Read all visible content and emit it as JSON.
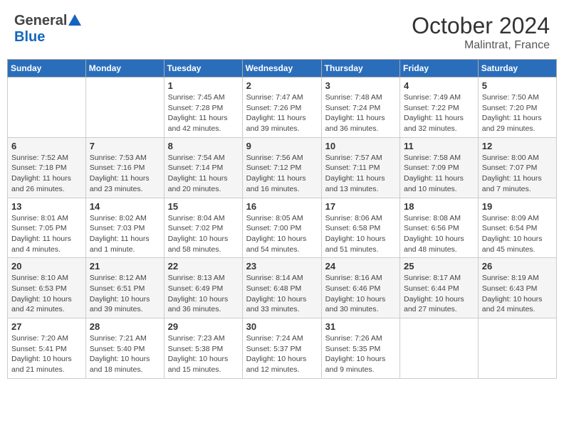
{
  "header": {
    "logo_general": "General",
    "logo_blue": "Blue",
    "month": "October 2024",
    "location": "Malintrat, France"
  },
  "days_of_week": [
    "Sunday",
    "Monday",
    "Tuesday",
    "Wednesday",
    "Thursday",
    "Friday",
    "Saturday"
  ],
  "weeks": [
    [
      {
        "day": "",
        "details": ""
      },
      {
        "day": "",
        "details": ""
      },
      {
        "day": "1",
        "details": "Sunrise: 7:45 AM\nSunset: 7:28 PM\nDaylight: 11 hours and 42 minutes."
      },
      {
        "day": "2",
        "details": "Sunrise: 7:47 AM\nSunset: 7:26 PM\nDaylight: 11 hours and 39 minutes."
      },
      {
        "day": "3",
        "details": "Sunrise: 7:48 AM\nSunset: 7:24 PM\nDaylight: 11 hours and 36 minutes."
      },
      {
        "day": "4",
        "details": "Sunrise: 7:49 AM\nSunset: 7:22 PM\nDaylight: 11 hours and 32 minutes."
      },
      {
        "day": "5",
        "details": "Sunrise: 7:50 AM\nSunset: 7:20 PM\nDaylight: 11 hours and 29 minutes."
      }
    ],
    [
      {
        "day": "6",
        "details": "Sunrise: 7:52 AM\nSunset: 7:18 PM\nDaylight: 11 hours and 26 minutes."
      },
      {
        "day": "7",
        "details": "Sunrise: 7:53 AM\nSunset: 7:16 PM\nDaylight: 11 hours and 23 minutes."
      },
      {
        "day": "8",
        "details": "Sunrise: 7:54 AM\nSunset: 7:14 PM\nDaylight: 11 hours and 20 minutes."
      },
      {
        "day": "9",
        "details": "Sunrise: 7:56 AM\nSunset: 7:12 PM\nDaylight: 11 hours and 16 minutes."
      },
      {
        "day": "10",
        "details": "Sunrise: 7:57 AM\nSunset: 7:11 PM\nDaylight: 11 hours and 13 minutes."
      },
      {
        "day": "11",
        "details": "Sunrise: 7:58 AM\nSunset: 7:09 PM\nDaylight: 11 hours and 10 minutes."
      },
      {
        "day": "12",
        "details": "Sunrise: 8:00 AM\nSunset: 7:07 PM\nDaylight: 11 hours and 7 minutes."
      }
    ],
    [
      {
        "day": "13",
        "details": "Sunrise: 8:01 AM\nSunset: 7:05 PM\nDaylight: 11 hours and 4 minutes."
      },
      {
        "day": "14",
        "details": "Sunrise: 8:02 AM\nSunset: 7:03 PM\nDaylight: 11 hours and 1 minute."
      },
      {
        "day": "15",
        "details": "Sunrise: 8:04 AM\nSunset: 7:02 PM\nDaylight: 10 hours and 58 minutes."
      },
      {
        "day": "16",
        "details": "Sunrise: 8:05 AM\nSunset: 7:00 PM\nDaylight: 10 hours and 54 minutes."
      },
      {
        "day": "17",
        "details": "Sunrise: 8:06 AM\nSunset: 6:58 PM\nDaylight: 10 hours and 51 minutes."
      },
      {
        "day": "18",
        "details": "Sunrise: 8:08 AM\nSunset: 6:56 PM\nDaylight: 10 hours and 48 minutes."
      },
      {
        "day": "19",
        "details": "Sunrise: 8:09 AM\nSunset: 6:54 PM\nDaylight: 10 hours and 45 minutes."
      }
    ],
    [
      {
        "day": "20",
        "details": "Sunrise: 8:10 AM\nSunset: 6:53 PM\nDaylight: 10 hours and 42 minutes."
      },
      {
        "day": "21",
        "details": "Sunrise: 8:12 AM\nSunset: 6:51 PM\nDaylight: 10 hours and 39 minutes."
      },
      {
        "day": "22",
        "details": "Sunrise: 8:13 AM\nSunset: 6:49 PM\nDaylight: 10 hours and 36 minutes."
      },
      {
        "day": "23",
        "details": "Sunrise: 8:14 AM\nSunset: 6:48 PM\nDaylight: 10 hours and 33 minutes."
      },
      {
        "day": "24",
        "details": "Sunrise: 8:16 AM\nSunset: 6:46 PM\nDaylight: 10 hours and 30 minutes."
      },
      {
        "day": "25",
        "details": "Sunrise: 8:17 AM\nSunset: 6:44 PM\nDaylight: 10 hours and 27 minutes."
      },
      {
        "day": "26",
        "details": "Sunrise: 8:19 AM\nSunset: 6:43 PM\nDaylight: 10 hours and 24 minutes."
      }
    ],
    [
      {
        "day": "27",
        "details": "Sunrise: 7:20 AM\nSunset: 5:41 PM\nDaylight: 10 hours and 21 minutes."
      },
      {
        "day": "28",
        "details": "Sunrise: 7:21 AM\nSunset: 5:40 PM\nDaylight: 10 hours and 18 minutes."
      },
      {
        "day": "29",
        "details": "Sunrise: 7:23 AM\nSunset: 5:38 PM\nDaylight: 10 hours and 15 minutes."
      },
      {
        "day": "30",
        "details": "Sunrise: 7:24 AM\nSunset: 5:37 PM\nDaylight: 10 hours and 12 minutes."
      },
      {
        "day": "31",
        "details": "Sunrise: 7:26 AM\nSunset: 5:35 PM\nDaylight: 10 hours and 9 minutes."
      },
      {
        "day": "",
        "details": ""
      },
      {
        "day": "",
        "details": ""
      }
    ]
  ]
}
